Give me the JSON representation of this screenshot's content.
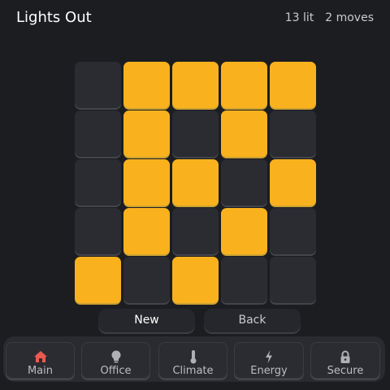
{
  "header": {
    "title": "Lights Out",
    "lit_count": "13 lit",
    "moves": "2 moves"
  },
  "board": {
    "size": 5,
    "rows": [
      [
        0,
        1,
        1,
        1,
        1
      ],
      [
        0,
        1,
        0,
        1,
        0
      ],
      [
        0,
        1,
        1,
        0,
        1
      ],
      [
        0,
        1,
        0,
        1,
        0
      ],
      [
        1,
        0,
        1,
        0,
        0
      ]
    ],
    "on_color": "#f9b21d",
    "off_color": "#2b2c31"
  },
  "buttons": {
    "new_label": "New",
    "back_label": "Back"
  },
  "nav": {
    "items": [
      {
        "label": "Main",
        "icon": "home-icon",
        "active": true
      },
      {
        "label": "Office",
        "icon": "lightbulb-icon",
        "active": false
      },
      {
        "label": "Climate",
        "icon": "thermometer-icon",
        "active": false
      },
      {
        "label": "Energy",
        "icon": "lightning-icon",
        "active": false
      },
      {
        "label": "Secure",
        "icon": "lock-icon",
        "active": false
      }
    ],
    "accent_color": "#f9b21d",
    "home_icon_color": "#e85a4f"
  }
}
